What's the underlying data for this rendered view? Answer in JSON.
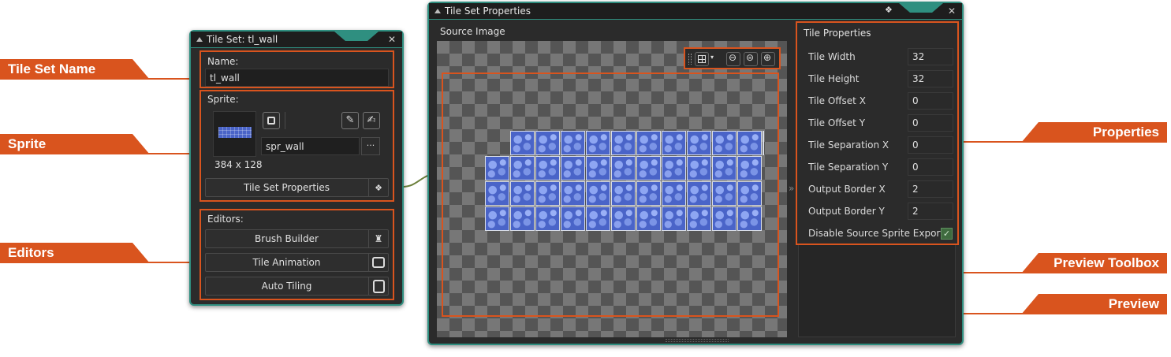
{
  "callouts": {
    "tile_set_name": "Tile Set Name",
    "sprite": "Sprite",
    "editors": "Editors",
    "properties": "Properties",
    "preview_toolbox": "Preview Toolbox",
    "preview": "Preview"
  },
  "tileset_window": {
    "title": "Tile Set: tl_wall",
    "name_label": "Name:",
    "name_value": "tl_wall",
    "sprite_label": "Sprite:",
    "sprite_name": "spr_wall",
    "sprite_size": "384 x 128",
    "browse_label": "···",
    "properties_button": "Tile Set Properties",
    "editors_label": "Editors:",
    "editors": [
      "Brush Builder",
      "Tile Animation",
      "Auto Tiling"
    ]
  },
  "props_window": {
    "title": "Tile Set Properties",
    "source_image_label": "Source Image",
    "tile_properties_title": "Tile Properties",
    "properties": [
      {
        "label": "Tile Width",
        "value": "32"
      },
      {
        "label": "Tile Height",
        "value": "32"
      },
      {
        "label": "Tile Offset X",
        "value": "0"
      },
      {
        "label": "Tile Offset Y",
        "value": "0"
      },
      {
        "label": "Tile Separation X",
        "value": "0"
      },
      {
        "label": "Tile Separation Y",
        "value": "0"
      },
      {
        "label": "Output Border X",
        "value": "2"
      },
      {
        "label": "Output Border Y",
        "value": "2"
      }
    ],
    "disable_export_label": "Disable Source Sprite Export",
    "disable_export_checked": true
  },
  "colors": {
    "accent": "#d9541e",
    "frame": "#2f8f80",
    "panel": "#2b2b2b"
  }
}
